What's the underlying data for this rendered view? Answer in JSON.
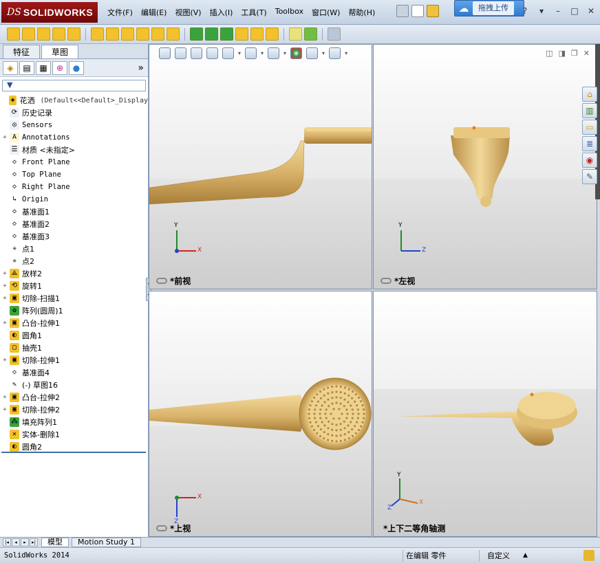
{
  "app": {
    "brand": "SOLIDWORKS",
    "logo_prefix": "DS",
    "upload_button": "拖拽上传"
  },
  "menu": [
    "文件(F)",
    "编辑(E)",
    "视图(V)",
    "插入(I)",
    "工具(T)",
    "Toolbox",
    "窗口(W)",
    "帮助(H)"
  ],
  "feature_manager": {
    "tabs": [
      "特征",
      "草图"
    ],
    "active_tab": 1,
    "more_label": "»",
    "filter_icon": "funnel-icon",
    "tree": [
      {
        "name": "花洒",
        "extra": "(Default<<Default>_Display",
        "icon": "part-icon",
        "exp": "",
        "mono": false
      },
      {
        "name": "历史记录",
        "icon": "history-icon",
        "exp": "",
        "mono": false
      },
      {
        "name": "Sensors",
        "icon": "sensor-icon",
        "exp": "",
        "mono": true
      },
      {
        "name": "Annotations",
        "icon": "annotation-icon",
        "exp": "+",
        "mono": true
      },
      {
        "name": "材质 <未指定>",
        "icon": "material-icon",
        "exp": "",
        "mono": false
      },
      {
        "name": "Front Plane",
        "icon": "plane-icon",
        "exp": "",
        "mono": true
      },
      {
        "name": "Top Plane",
        "icon": "plane-icon",
        "exp": "",
        "mono": true
      },
      {
        "name": "Right Plane",
        "icon": "plane-icon",
        "exp": "",
        "mono": true
      },
      {
        "name": "Origin",
        "icon": "origin-icon",
        "exp": "",
        "mono": true
      },
      {
        "name": "基准面1",
        "icon": "plane-icon",
        "exp": "",
        "mono": false
      },
      {
        "name": "基准面2",
        "icon": "plane-icon",
        "exp": "",
        "mono": false
      },
      {
        "name": "基准面3",
        "icon": "plane-icon",
        "exp": "",
        "mono": false
      },
      {
        "name": "点1",
        "icon": "point-icon",
        "exp": "",
        "mono": false
      },
      {
        "name": "点2",
        "icon": "point-icon",
        "exp": "",
        "mono": false
      },
      {
        "name": "放样2",
        "icon": "loft-icon",
        "exp": "+",
        "mono": false
      },
      {
        "name": "旋转1",
        "icon": "revolve-icon",
        "exp": "+",
        "mono": false
      },
      {
        "name": "切除-扫描1",
        "icon": "sweep-cut-icon",
        "exp": "+",
        "mono": false
      },
      {
        "name": "阵列(圆周)1",
        "icon": "circular-pattern-icon",
        "exp": "",
        "mono": false
      },
      {
        "name": "凸台-拉伸1",
        "icon": "boss-extrude-icon",
        "exp": "+",
        "mono": false
      },
      {
        "name": "圆角1",
        "icon": "fillet-icon",
        "exp": "",
        "mono": false
      },
      {
        "name": "抽壳1",
        "icon": "shell-icon",
        "exp": "",
        "mono": false
      },
      {
        "name": "切除-拉伸1",
        "icon": "cut-extrude-icon",
        "exp": "+",
        "mono": false
      },
      {
        "name": "基准面4",
        "icon": "plane-icon",
        "exp": "",
        "mono": false
      },
      {
        "name": "(-) 草图16",
        "icon": "sketch-icon",
        "exp": "",
        "mono": false
      },
      {
        "name": "凸台-拉伸2",
        "icon": "boss-extrude-icon",
        "exp": "+",
        "mono": false
      },
      {
        "name": "切除-拉伸2",
        "icon": "cut-extrude-icon",
        "exp": "+",
        "mono": false
      },
      {
        "name": "填充阵列1",
        "icon": "fill-pattern-icon",
        "exp": "",
        "mono": false
      },
      {
        "name": "实体-删除1",
        "icon": "delete-body-icon",
        "exp": "",
        "mono": false
      },
      {
        "name": "圆角2",
        "icon": "fillet-icon",
        "exp": "",
        "mono": false
      }
    ]
  },
  "viewports": {
    "front": "*前视",
    "left": "*左视",
    "top": "*上视",
    "iso": "*上下二等角轴测"
  },
  "axes": {
    "x": "X",
    "y": "Y",
    "z": "Z"
  },
  "bottom_tabs": [
    "模型",
    "Motion Study 1"
  ],
  "status": {
    "version": "SolidWorks 2014",
    "mode": "在编辑 零件",
    "units": "自定义",
    "caret": "▲"
  },
  "colors": {
    "model_gold": "#d9b26a",
    "model_shadow": "#a87f38",
    "model_highlight": "#f2d99a",
    "axis_x": "#d42020",
    "axis_y": "#1f8a2a",
    "axis_z": "#2442c8",
    "brand_red": "#8c1010"
  }
}
